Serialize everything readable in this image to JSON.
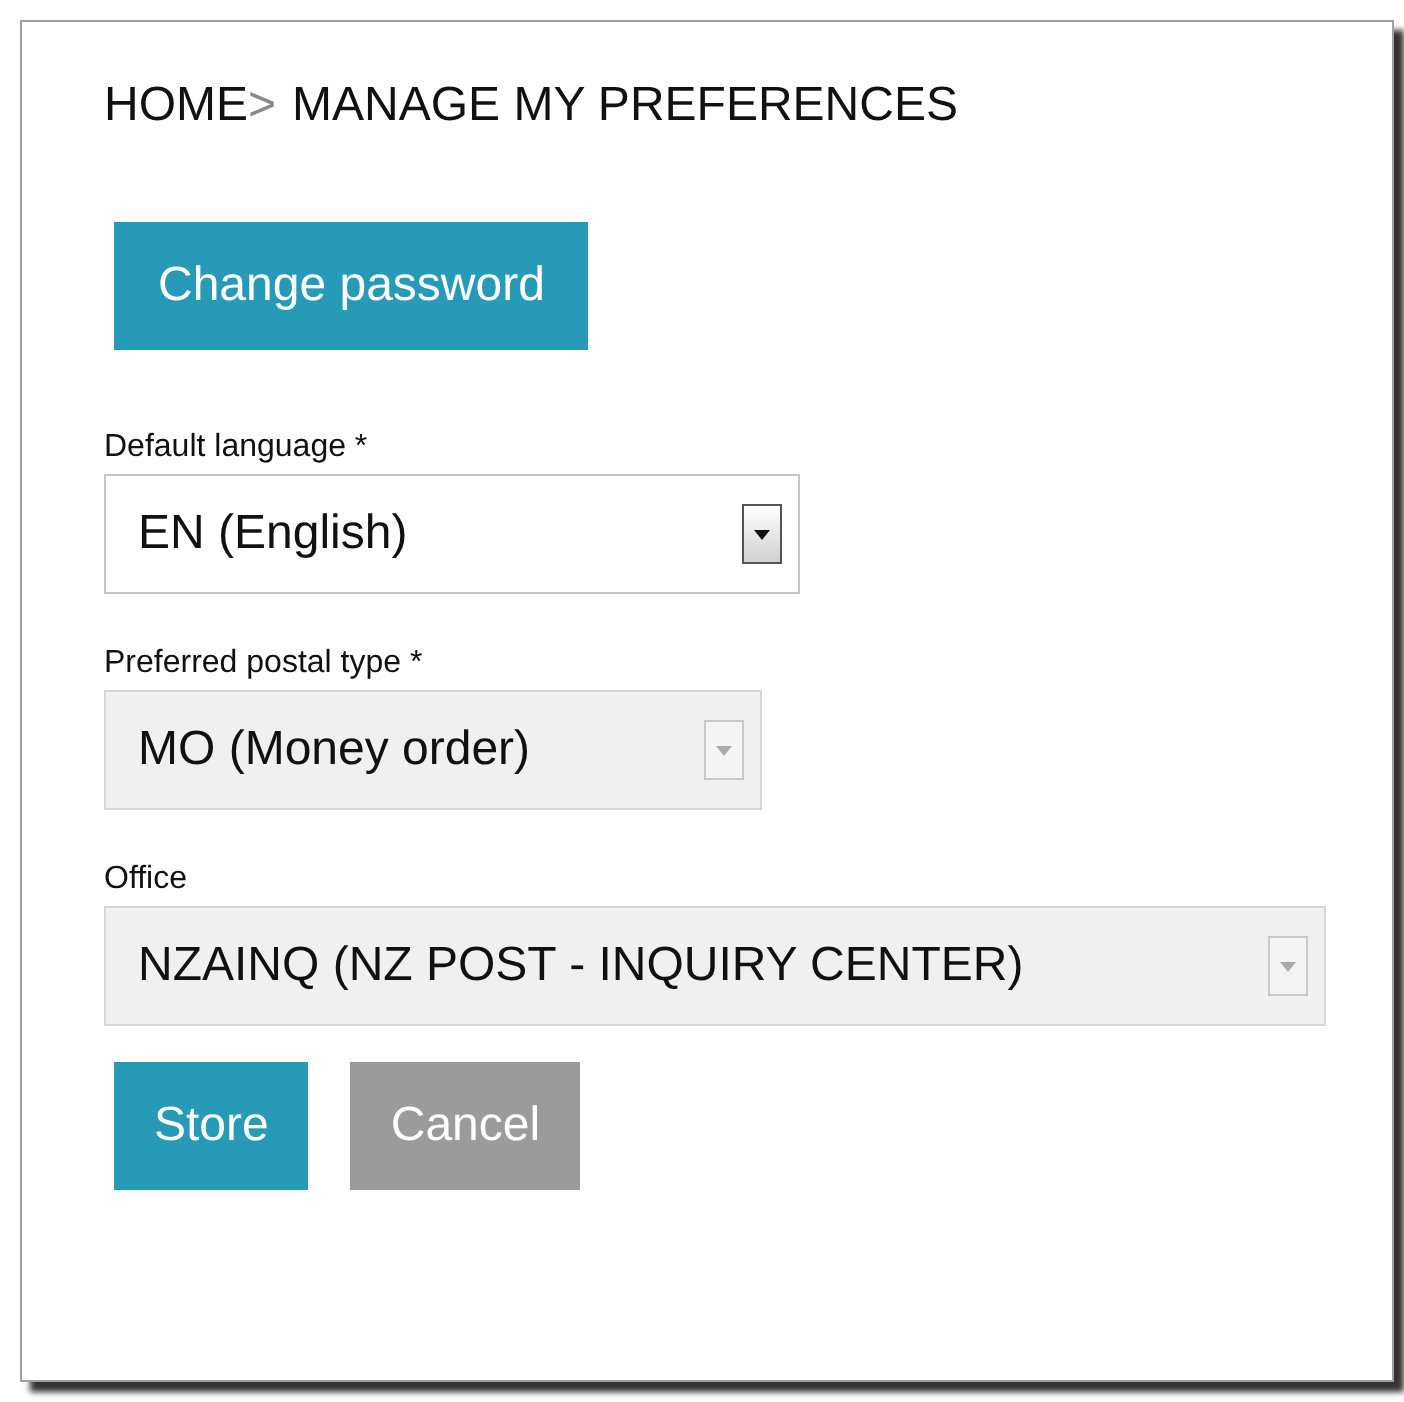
{
  "breadcrumb": {
    "home": "HOME",
    "separator": ">",
    "current": "MANAGE MY PREFERENCES"
  },
  "change_password_button": "Change password",
  "fields": [
    {
      "label": "Default language *",
      "value": "EN (English)",
      "disabled": false
    },
    {
      "label": "Preferred postal type *",
      "value": "MO (Money order)",
      "disabled": true
    },
    {
      "label": "Office",
      "value": "NZAINQ (NZ POST - INQUIRY CENTER)",
      "disabled": true
    }
  ],
  "buttons": [
    {
      "label": "Store",
      "kind": "primary"
    },
    {
      "label": "Cancel",
      "kind": "secondary"
    }
  ]
}
